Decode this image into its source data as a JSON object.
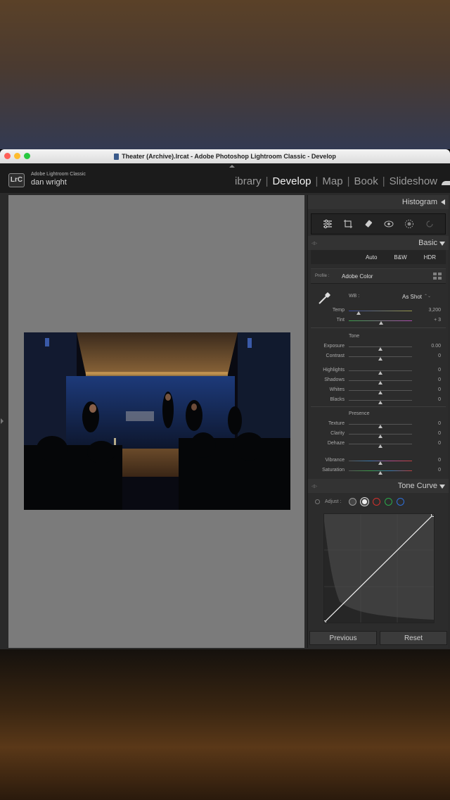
{
  "window": {
    "title": "Theater (Archive).lrcat - Adobe Photoshop Lightroom Classic - Develop"
  },
  "header": {
    "logo": "LrC",
    "app_name": "Adobe Lightroom Classic",
    "user": "dan wright",
    "modules": [
      "ibrary",
      "Develop",
      "Map",
      "Book",
      "Slideshow"
    ],
    "active_module": "Develop"
  },
  "panels": {
    "histogram": {
      "title": "Histogram"
    },
    "basic": {
      "title": "Basic",
      "buttons": [
        "Auto",
        "B&W",
        "HDR"
      ],
      "profile_label": "Profile :",
      "profile_value": "Adobe Color",
      "wb_label": "WB :",
      "wb_value": "As Shot",
      "wb_arrows": "⌃⌄",
      "temp": {
        "label": "Temp",
        "value": "3,200",
        "position": 0.15
      },
      "tint": {
        "label": "Tint",
        "value": "+ 3",
        "position": 0.51
      },
      "tone_heading": "Tone",
      "tone": [
        {
          "label": "Exposure",
          "value": "0.00",
          "position": 0.5
        },
        {
          "label": "Contrast",
          "value": "0",
          "position": 0.5
        },
        {
          "label": "Highlights",
          "value": "0",
          "position": 0.5
        },
        {
          "label": "Shadows",
          "value": "0",
          "position": 0.5
        },
        {
          "label": "Whites",
          "value": "0",
          "position": 0.5
        },
        {
          "label": "Blacks",
          "value": "0",
          "position": 0.5
        }
      ],
      "presence_heading": "Presence",
      "presence": [
        {
          "label": "Texture",
          "value": "0",
          "position": 0.5
        },
        {
          "label": "Clarity",
          "value": "0",
          "position": 0.5
        },
        {
          "label": "Dehaze",
          "value": "0",
          "position": 0.5
        }
      ],
      "color": [
        {
          "label": "Vibrance",
          "value": "0",
          "position": 0.5
        },
        {
          "label": "Saturation",
          "value": "0",
          "position": 0.5
        }
      ]
    },
    "tone_curve": {
      "title": "Tone Curve",
      "adjust_label": "Adjust :"
    }
  },
  "footer": {
    "previous": "Previous",
    "reset": "Reset"
  },
  "colors": {
    "accent_active": "#f2f2f2",
    "panel_bg": "#2c2c2c",
    "canvas_bg": "#7b7b7b",
    "channel_red": "#d0312d",
    "channel_green": "#2aa84a",
    "channel_blue": "#2f6fd8"
  },
  "icons": [
    "sliders-icon",
    "crop-icon",
    "heal-icon",
    "redeye-icon",
    "mask-icon",
    "reset-icon",
    "eyedropper-icon",
    "point-curve-icon",
    "grid-icon"
  ]
}
